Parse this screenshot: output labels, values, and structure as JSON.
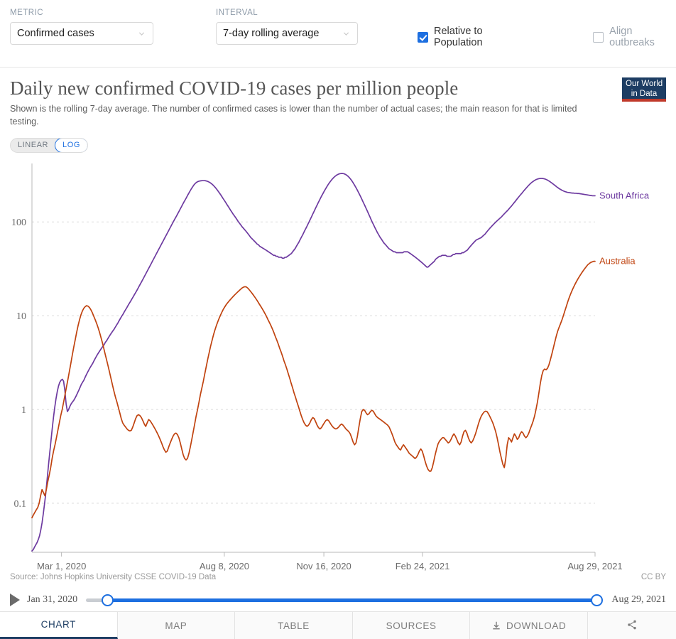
{
  "controls": {
    "metric": {
      "label": "METRIC",
      "value": "Confirmed cases"
    },
    "interval": {
      "label": "INTERVAL",
      "value": "7-day rolling average"
    },
    "relative_to_population": {
      "label": "Relative to Population",
      "checked": true
    },
    "align_outbreaks": {
      "label": "Align outbreaks",
      "checked": false
    }
  },
  "header": {
    "title": "Daily new confirmed COVID-19 cases per million people",
    "subtitle": "Shown is the rolling 7-day average. The number of confirmed cases is lower than the number of actual cases; the main reason for that is limited testing.",
    "logo_line1": "Our World",
    "logo_line2": "in Data"
  },
  "scale": {
    "linear": "LINEAR",
    "log": "LOG",
    "selected": "LOG"
  },
  "footer": {
    "source": "Source: Johns Hopkins University CSSE COVID-19 Data",
    "license": "CC BY"
  },
  "slider": {
    "start": "Jan 31, 2020",
    "end": "Aug 29, 2021"
  },
  "tabs": [
    {
      "label": "CHART",
      "active": true
    },
    {
      "label": "MAP",
      "active": false
    },
    {
      "label": "TABLE",
      "active": false
    },
    {
      "label": "SOURCES",
      "active": false
    },
    {
      "label": "DOWNLOAD",
      "active": false,
      "icon": "download-icon"
    },
    {
      "label": "",
      "active": false,
      "icon": "share-icon"
    }
  ],
  "colors": {
    "south_africa": "#6d3aa0",
    "australia": "#c0430f",
    "accent": "#1d6fe0",
    "brand": "#1d3d63",
    "grid": "#dcdcdc"
  },
  "chart_data": {
    "type": "line",
    "title": "Daily new confirmed COVID-19 cases per million people",
    "subtitle": "Shown is the rolling 7-day average. The number of confirmed cases is lower than the number of actual cases; the main reason for that is limited testing.",
    "xlabel": "",
    "ylabel": "Daily new confirmed cases per million people",
    "yscale": "log",
    "ylim": [
      0.03,
      420
    ],
    "ytick_values": [
      0.1,
      1,
      10,
      100
    ],
    "ytick_labels": [
      "0.1",
      "1",
      "10",
      "100"
    ],
    "grid": true,
    "legend": "inline-right",
    "x_start": "Jan 31, 2020",
    "x_end": "Aug 29, 2021",
    "xticks": [
      {
        "label": "Mar 1, 2020",
        "t": 0.0525
      },
      {
        "label": "Aug 8, 2020",
        "t": 0.3416
      },
      {
        "label": "Nov 16, 2020",
        "t": 0.5184
      },
      {
        "label": "Feb 24, 2021",
        "t": 0.6936
      },
      {
        "label": "Aug 29, 2021",
        "t": 1.0
      }
    ],
    "series": [
      {
        "name": "South Africa",
        "color": "#6d3aa0",
        "label_t": 1.0,
        "label_value": 190,
        "values": [
          0.031,
          0.032,
          0.034,
          0.036,
          0.038,
          0.041,
          0.045,
          0.052,
          0.062,
          0.078,
          0.1,
          0.13,
          0.18,
          0.25,
          0.34,
          0.46,
          0.62,
          0.82,
          1.05,
          1.3,
          1.55,
          1.78,
          1.95,
          2.05,
          2.1,
          2.0,
          1.6,
          1.15,
          0.95,
          1.0,
          1.08,
          1.15,
          1.2,
          1.25,
          1.32,
          1.4,
          1.5,
          1.6,
          1.72,
          1.85,
          1.95,
          2.05,
          2.2,
          2.35,
          2.5,
          2.65,
          2.8,
          2.95,
          3.1,
          3.3,
          3.5,
          3.7,
          3.9,
          4.1,
          4.3,
          4.5,
          4.7,
          4.9,
          5.2,
          5.4,
          5.7,
          6.0,
          6.3,
          6.6,
          6.9,
          7.2,
          7.6,
          8.0,
          8.4,
          8.9,
          9.4,
          9.9,
          10.4,
          11.0,
          11.6,
          12.2,
          12.9,
          13.6,
          14.3,
          15.1,
          15.9,
          16.8,
          17.7,
          18.7,
          19.8,
          21.0,
          22.2,
          23.5,
          24.9,
          26.4,
          28.0,
          29.7,
          31.5,
          33.4,
          35.4,
          37.6,
          39.9,
          42.3,
          44.9,
          47.6,
          50.5,
          53.5,
          56.8,
          60.2,
          63.8,
          67.7,
          71.8,
          76.1,
          80.7,
          85.6,
          90.8,
          96.3,
          102,
          108,
          114,
          121,
          128,
          136,
          144,
          153,
          162,
          171,
          181,
          192,
          203,
          214,
          226,
          237,
          248,
          257,
          264,
          269,
          272,
          274,
          275,
          276,
          276,
          275,
          273,
          270,
          266,
          261,
          255,
          248,
          240,
          232,
          223,
          214,
          205,
          196,
          187,
          178,
          170,
          162,
          154,
          147,
          140,
          133,
          127,
          121,
          116,
          111,
          106,
          101,
          97,
          93,
          89,
          86,
          83,
          80,
          77,
          74,
          71,
          68,
          66,
          64,
          62,
          60,
          58,
          57,
          55,
          54,
          53,
          52,
          51,
          50,
          49,
          48,
          47,
          46,
          45,
          44,
          44,
          43,
          43,
          42,
          42,
          42,
          41,
          41,
          42,
          42,
          43,
          44,
          45,
          46,
          48,
          50,
          52,
          55,
          58,
          61,
          65,
          69,
          73,
          78,
          83,
          88,
          94,
          100,
          107,
          114,
          122,
          130,
          139,
          148,
          158,
          168,
          179,
          190,
          201,
          213,
          225,
          237,
          249,
          261,
          272,
          283,
          293,
          302,
          310,
          317,
          322,
          326,
          328,
          329,
          328,
          325,
          320,
          313,
          305,
          295,
          284,
          272,
          259,
          246,
          233,
          220,
          207,
          195,
          183,
          171,
          160,
          150,
          140,
          131,
          122,
          114,
          106,
          99,
          93,
          87,
          82,
          77,
          73,
          69,
          66,
          63,
          60,
          58,
          56,
          54,
          52,
          51,
          50,
          49,
          48,
          48,
          47,
          47,
          47,
          47,
          47,
          47,
          48,
          48,
          48,
          48,
          47,
          46,
          45,
          44,
          43,
          42,
          41,
          40,
          39,
          38,
          37,
          36,
          35,
          34,
          33,
          33,
          34,
          35,
          36,
          37,
          38,
          40,
          41,
          42,
          43,
          43,
          44,
          44,
          44,
          44,
          43,
          43,
          43,
          43,
          44,
          45,
          45,
          46,
          46,
          46,
          46,
          46,
          47,
          47,
          48,
          49,
          50,
          52,
          54,
          56,
          58,
          60,
          62,
          64,
          65,
          66,
          67,
          68,
          70,
          72,
          74,
          77,
          80,
          83,
          86,
          89,
          92,
          95,
          98,
          101,
          104,
          107,
          110,
          113,
          117,
          121,
          125,
          129,
          133,
          138,
          143,
          148,
          154,
          160,
          166,
          173,
          180,
          187,
          194,
          201,
          209,
          217,
          225,
          233,
          241,
          249,
          257,
          264,
          270,
          276,
          281,
          285,
          288,
          290,
          291,
          291,
          290,
          288,
          285,
          281,
          276,
          271,
          265,
          259,
          253,
          247,
          241,
          235,
          230,
          225,
          221,
          217,
          214,
          211,
          209,
          207,
          206,
          205,
          204,
          203,
          203,
          202,
          202,
          201,
          201,
          200,
          199,
          198,
          197,
          196,
          195,
          194,
          193,
          192,
          191,
          190,
          190,
          190
        ]
      },
      {
        "name": "Australia",
        "color": "#c0430f",
        "label_t": 1.0,
        "label_value": 38,
        "values": [
          0.07,
          0.075,
          0.08,
          0.085,
          0.09,
          0.1,
          0.12,
          0.14,
          0.13,
          0.12,
          0.14,
          0.17,
          0.2,
          0.24,
          0.3,
          0.36,
          0.42,
          0.5,
          0.6,
          0.72,
          0.86,
          1.0,
          1.2,
          1.45,
          1.75,
          2.1,
          2.55,
          3.1,
          3.8,
          4.6,
          5.5,
          6.6,
          7.8,
          9.0,
          10.2,
          11.2,
          12.0,
          12.5,
          12.8,
          12.6,
          12.2,
          11.5,
          10.7,
          9.8,
          9.0,
          8.2,
          7.4,
          6.6,
          5.8,
          5.1,
          4.4,
          3.8,
          3.3,
          2.85,
          2.45,
          2.1,
          1.8,
          1.55,
          1.35,
          1.2,
          1.05,
          0.92,
          0.8,
          0.72,
          0.68,
          0.65,
          0.62,
          0.6,
          0.59,
          0.6,
          0.65,
          0.72,
          0.8,
          0.86,
          0.88,
          0.86,
          0.82,
          0.76,
          0.7,
          0.66,
          0.72,
          0.78,
          0.76,
          0.72,
          0.68,
          0.64,
          0.6,
          0.56,
          0.52,
          0.48,
          0.44,
          0.4,
          0.37,
          0.35,
          0.36,
          0.4,
          0.44,
          0.48,
          0.52,
          0.55,
          0.56,
          0.54,
          0.5,
          0.44,
          0.38,
          0.33,
          0.3,
          0.29,
          0.3,
          0.34,
          0.4,
          0.48,
          0.58,
          0.7,
          0.85,
          1.0,
          1.2,
          1.45,
          1.7,
          2.0,
          2.4,
          2.85,
          3.4,
          4.0,
          4.7,
          5.4,
          6.2,
          7.0,
          7.8,
          8.6,
          9.4,
          10.2,
          11.0,
          11.8,
          12.5,
          13.2,
          13.8,
          14.4,
          15.0,
          15.6,
          16.2,
          16.8,
          17.4,
          18.0,
          18.6,
          19.2,
          19.8,
          20.2,
          20.4,
          20.2,
          19.6,
          18.8,
          18.0,
          17.2,
          16.4,
          15.6,
          14.8,
          14.0,
          13.2,
          12.5,
          11.8,
          11.1,
          10.4,
          9.7,
          9.0,
          8.4,
          7.8,
          7.2,
          6.6,
          6.0,
          5.5,
          5.0,
          4.5,
          4.1,
          3.7,
          3.3,
          3.0,
          2.7,
          2.4,
          2.15,
          1.9,
          1.7,
          1.5,
          1.35,
          1.2,
          1.08,
          0.96,
          0.86,
          0.78,
          0.72,
          0.68,
          0.66,
          0.68,
          0.72,
          0.78,
          0.82,
          0.8,
          0.74,
          0.68,
          0.64,
          0.62,
          0.64,
          0.68,
          0.72,
          0.76,
          0.78,
          0.76,
          0.72,
          0.68,
          0.65,
          0.63,
          0.62,
          0.63,
          0.65,
          0.68,
          0.7,
          0.68,
          0.65,
          0.62,
          0.6,
          0.58,
          0.55,
          0.5,
          0.45,
          0.42,
          0.44,
          0.52,
          0.65,
          0.8,
          0.95,
          1.0,
          0.98,
          0.92,
          0.88,
          0.9,
          0.95,
          0.98,
          0.96,
          0.9,
          0.85,
          0.82,
          0.8,
          0.78,
          0.76,
          0.74,
          0.72,
          0.7,
          0.68,
          0.65,
          0.6,
          0.55,
          0.5,
          0.45,
          0.42,
          0.4,
          0.38,
          0.37,
          0.4,
          0.42,
          0.4,
          0.38,
          0.36,
          0.34,
          0.33,
          0.32,
          0.31,
          0.3,
          0.31,
          0.33,
          0.36,
          0.38,
          0.36,
          0.32,
          0.28,
          0.25,
          0.23,
          0.22,
          0.22,
          0.24,
          0.28,
          0.33,
          0.38,
          0.43,
          0.46,
          0.48,
          0.5,
          0.5,
          0.48,
          0.46,
          0.44,
          0.45,
          0.48,
          0.52,
          0.55,
          0.52,
          0.48,
          0.44,
          0.42,
          0.45,
          0.52,
          0.58,
          0.6,
          0.56,
          0.5,
          0.46,
          0.44,
          0.46,
          0.5,
          0.55,
          0.62,
          0.7,
          0.78,
          0.85,
          0.9,
          0.94,
          0.96,
          0.95,
          0.9,
          0.84,
          0.78,
          0.72,
          0.65,
          0.58,
          0.5,
          0.42,
          0.35,
          0.3,
          0.26,
          0.24,
          0.3,
          0.42,
          0.5,
          0.48,
          0.45,
          0.5,
          0.55,
          0.52,
          0.48,
          0.5,
          0.55,
          0.58,
          0.56,
          0.52,
          0.5,
          0.52,
          0.56,
          0.62,
          0.68,
          0.75,
          0.85,
          1.0,
          1.2,
          1.5,
          1.9,
          2.3,
          2.6,
          2.7,
          2.65,
          2.75,
          3.0,
          3.4,
          3.9,
          4.5,
          5.2,
          6.0,
          6.8,
          7.5,
          8.2,
          9.0,
          10.0,
          11.2,
          12.5,
          14.0,
          15.5,
          17.0,
          18.5,
          20.0,
          21.5,
          23.0,
          24.5,
          26.0,
          27.5,
          29.0,
          30.5,
          32.0,
          33.5,
          35.0,
          36.0,
          37.0,
          37.5,
          38.0,
          38.0
        ]
      }
    ]
  }
}
